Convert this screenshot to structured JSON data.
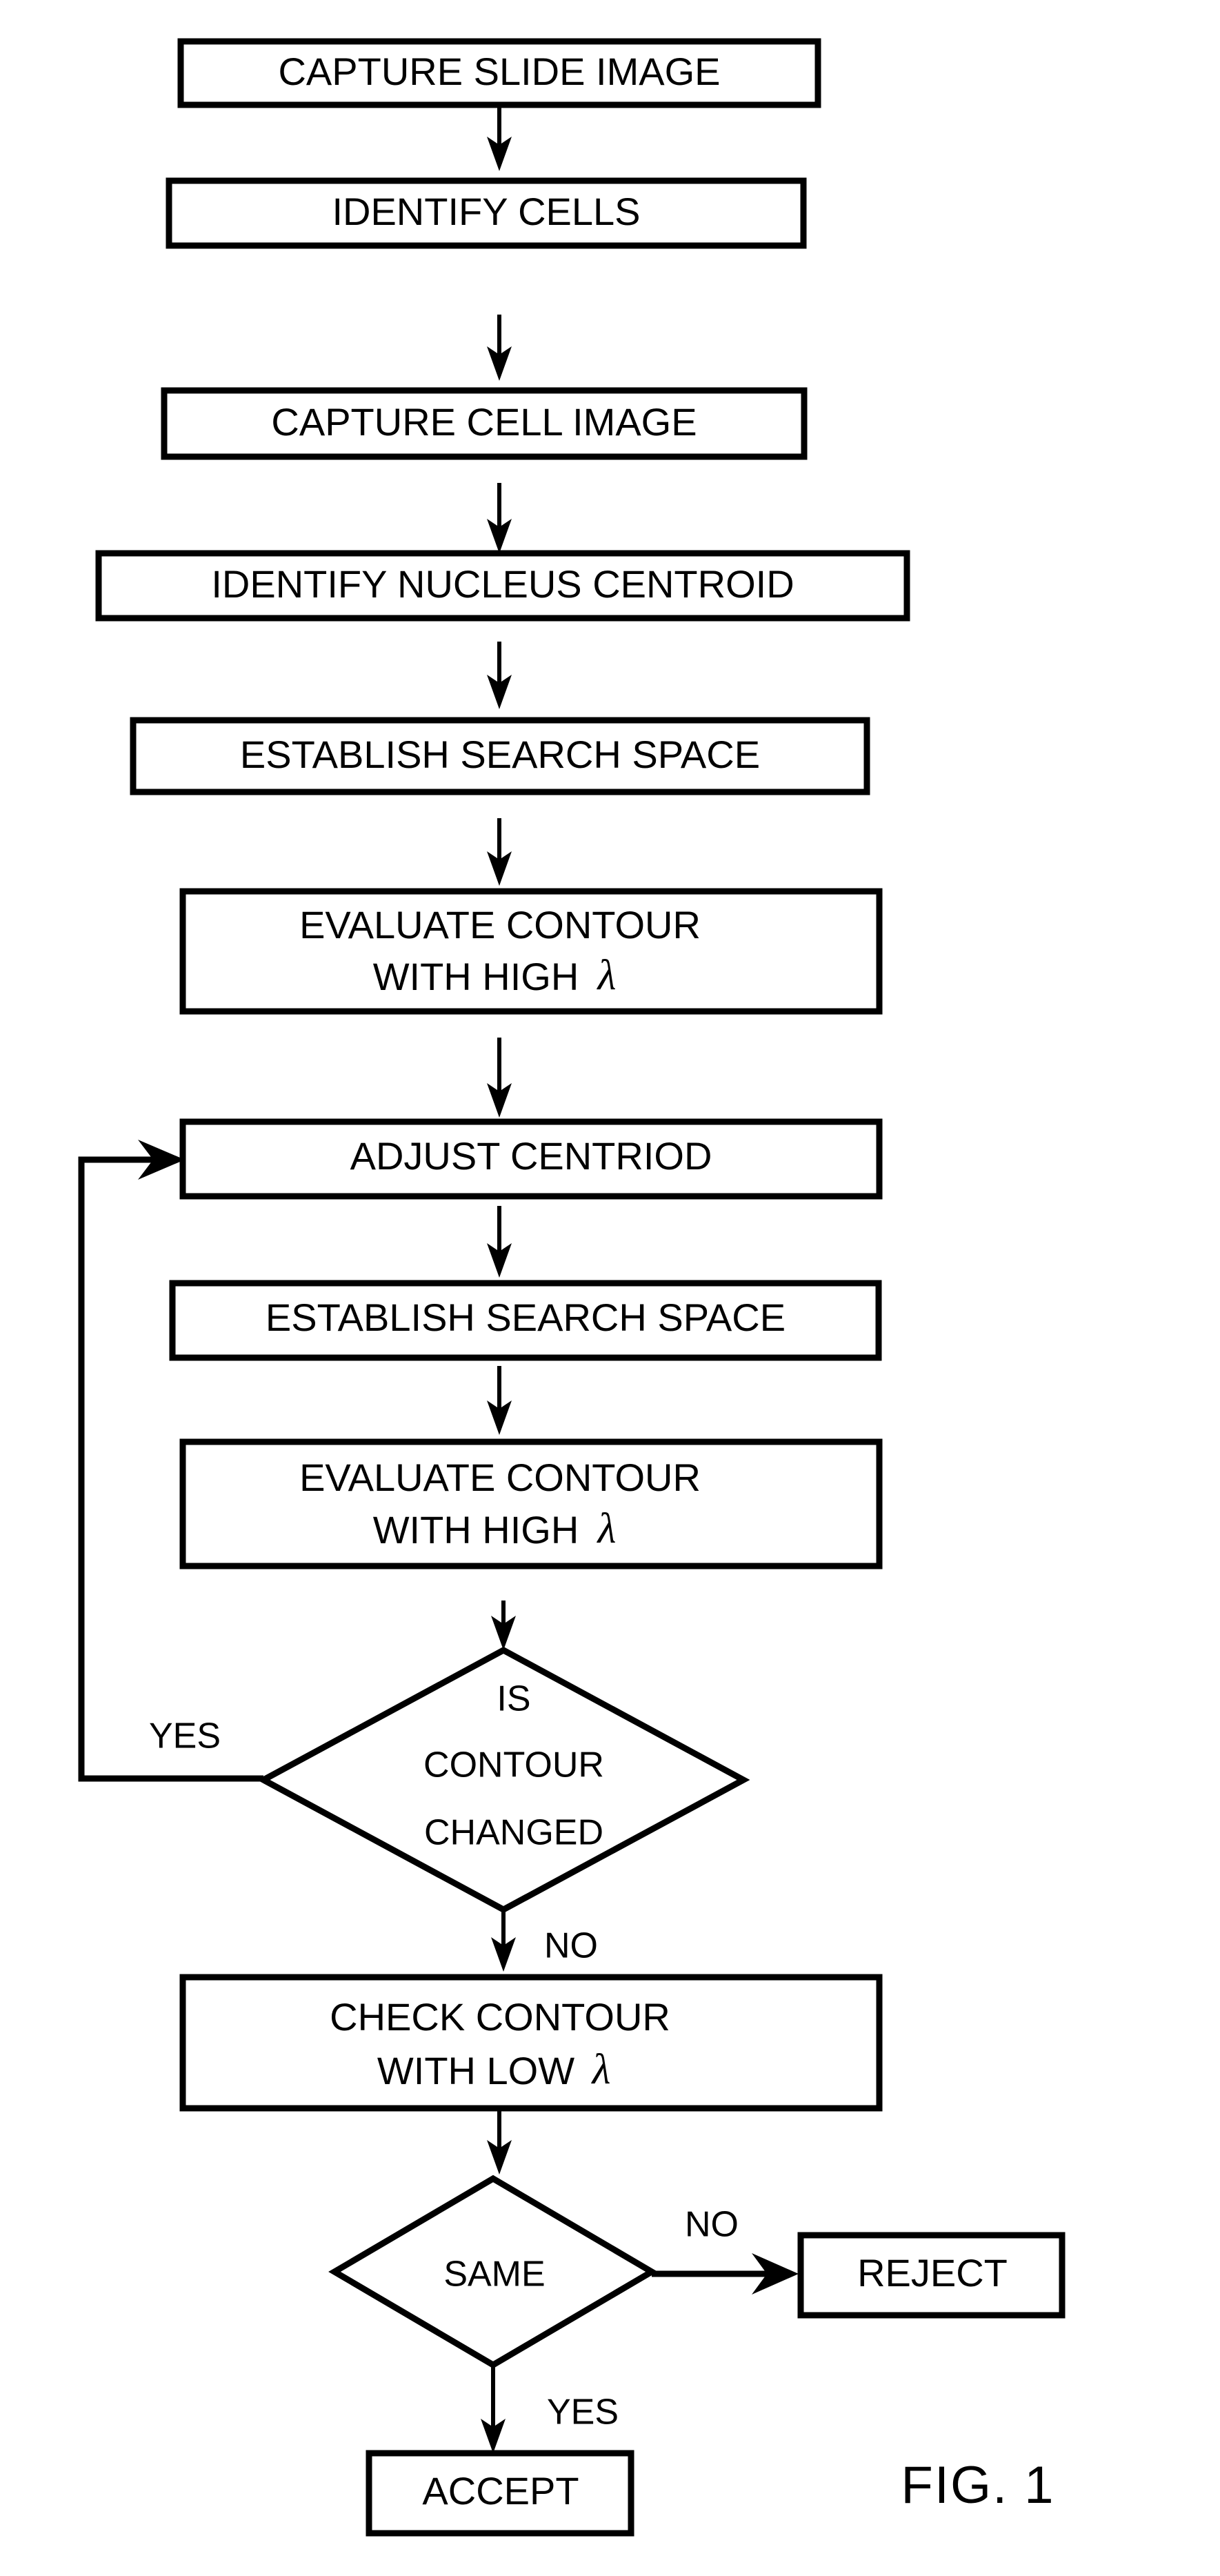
{
  "figure": {
    "caption": "FIG. 1",
    "type": "flowchart"
  },
  "chart_data": {
    "type": "diagram",
    "title": "FIG. 1",
    "nodes": [
      {
        "id": "n1",
        "shape": "process",
        "label": "CAPTURE SLIDE IMAGE"
      },
      {
        "id": "n2",
        "shape": "process",
        "label": "IDENTIFY CELLS"
      },
      {
        "id": "n3",
        "shape": "process",
        "label": "CAPTURE CELL IMAGE"
      },
      {
        "id": "n4",
        "shape": "process",
        "label": "IDENTIFY NUCLEUS CENTROID"
      },
      {
        "id": "n5",
        "shape": "process",
        "label": "ESTABLISH SEARCH SPACE"
      },
      {
        "id": "n6",
        "shape": "process",
        "label_line1": "EVALUATE CONTOUR",
        "label_line2": "WITH HIGH",
        "symbol": "λ"
      },
      {
        "id": "n7",
        "shape": "process",
        "label": "ADJUST CENTRIOD"
      },
      {
        "id": "n8",
        "shape": "process",
        "label": "ESTABLISH SEARCH SPACE"
      },
      {
        "id": "n9",
        "shape": "process",
        "label_line1": "EVALUATE CONTOUR",
        "label_line2": "WITH HIGH",
        "symbol": "λ"
      },
      {
        "id": "n10",
        "shape": "decision",
        "label_line1": "IS",
        "label_line2": "CONTOUR",
        "label_line3": "CHANGED"
      },
      {
        "id": "n11",
        "shape": "process",
        "label_line1": "CHECK CONTOUR",
        "label_line2": "WITH LOW",
        "symbol": "λ"
      },
      {
        "id": "n12",
        "shape": "decision",
        "label": "SAME"
      },
      {
        "id": "n13",
        "shape": "terminal",
        "label": "REJECT"
      },
      {
        "id": "n14",
        "shape": "terminal",
        "label": "ACCEPT"
      }
    ],
    "edges": [
      {
        "from": "n1",
        "to": "n2",
        "label": ""
      },
      {
        "from": "n2",
        "to": "n3",
        "label": ""
      },
      {
        "from": "n3",
        "to": "n4",
        "label": ""
      },
      {
        "from": "n4",
        "to": "n5",
        "label": ""
      },
      {
        "from": "n5",
        "to": "n6",
        "label": ""
      },
      {
        "from": "n6",
        "to": "n7",
        "label": ""
      },
      {
        "from": "n7",
        "to": "n8",
        "label": ""
      },
      {
        "from": "n8",
        "to": "n9",
        "label": ""
      },
      {
        "from": "n9",
        "to": "n10",
        "label": ""
      },
      {
        "from": "n10",
        "to": "n7",
        "label": "YES"
      },
      {
        "from": "n10",
        "to": "n11",
        "label": "NO"
      },
      {
        "from": "n11",
        "to": "n12",
        "label": ""
      },
      {
        "from": "n12",
        "to": "n13",
        "label": "NO"
      },
      {
        "from": "n12",
        "to": "n14",
        "label": "YES"
      }
    ],
    "edge_labels": {
      "loop_yes": "YES",
      "loop_no": "NO",
      "same_no": "NO",
      "same_yes": "YES"
    },
    "colors": {
      "stroke": "#000000",
      "fill": "#ffffff",
      "background": "#ffffff"
    }
  },
  "nodes": {
    "capture_slide_image": "CAPTURE SLIDE IMAGE",
    "identify_cells": "IDENTIFY CELLS",
    "capture_cell_image": "CAPTURE CELL IMAGE",
    "identify_nucleus_centroid": "IDENTIFY NUCLEUS CENTROID",
    "establish_search_space_1": "ESTABLISH SEARCH SPACE",
    "evaluate_contour_1_line1": "EVALUATE CONTOUR",
    "evaluate_contour_1_line2": "WITH HIGH",
    "evaluate_contour_1_symbol": "λ",
    "adjust_centriod": "ADJUST CENTRIOD",
    "establish_search_space_2": "ESTABLISH SEARCH SPACE",
    "evaluate_contour_2_line1": "EVALUATE CONTOUR",
    "evaluate_contour_2_line2": "WITH HIGH",
    "evaluate_contour_2_symbol": "λ",
    "is_contour_changed_line1": "IS",
    "is_contour_changed_line2": "CONTOUR",
    "is_contour_changed_line3": "CHANGED",
    "check_contour_line1": "CHECK CONTOUR",
    "check_contour_line2": "WITH LOW",
    "check_contour_symbol": "λ",
    "same": "SAME",
    "reject": "REJECT",
    "accept": "ACCEPT"
  },
  "labels": {
    "yes_loop": "YES",
    "no_to_check": "NO",
    "no_to_reject": "NO",
    "yes_to_accept": "YES",
    "figure_caption": "FIG. 1"
  }
}
